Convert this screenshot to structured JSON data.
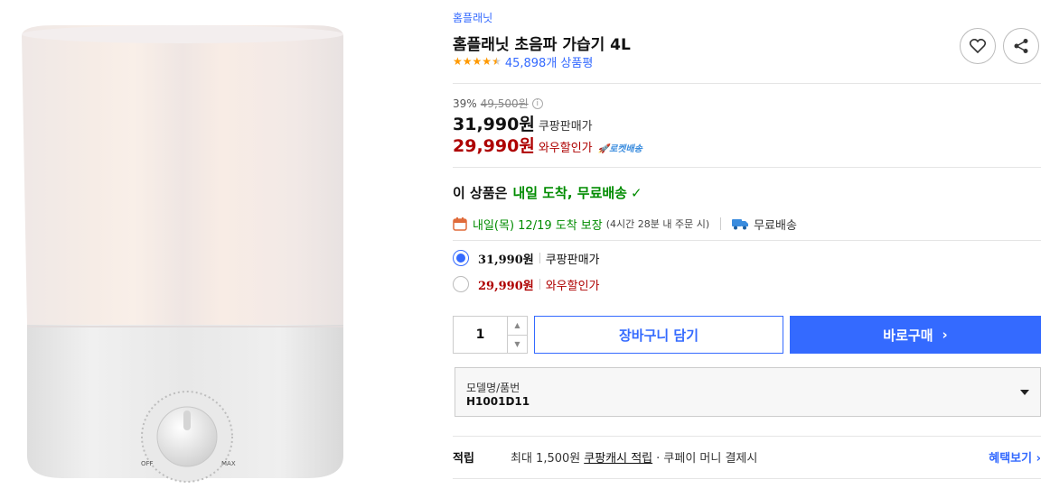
{
  "brand": "홈플래닛",
  "title": "홈플래닛 초음파 가습기 4L",
  "rating": {
    "value": 4.5,
    "count_text": "45,898개 상품평"
  },
  "price": {
    "discount": "39%",
    "original": "49,500원",
    "coupang_price": "31,990원",
    "coupang_label": "쿠팡판매가",
    "wow_price": "29,990원",
    "wow_label": "와우할인가",
    "rocket_badge": "로켓배송"
  },
  "delivery": {
    "head_prefix": "이 상품은",
    "head_highlight": "내일 도착, 무료배송",
    "date": "내일(목) 12/19 도착 보장",
    "note": "(4시간 28분 내 주문 시)",
    "free_shipping": "무료배송"
  },
  "options": [
    {
      "price": "31,990원",
      "label": "쿠팡판매가",
      "selected": true
    },
    {
      "price": "29,990원",
      "label": "와우할인가",
      "selected": false
    }
  ],
  "quantity": "1",
  "buttons": {
    "cart": "장바구니 담기",
    "buy": "바로구매"
  },
  "model": {
    "label": "모델명/품번",
    "value": "H1001D11"
  },
  "points": {
    "label": "적립",
    "text": "최대 1,500원",
    "link": "쿠팡캐시 적립",
    "rest": "· 쿠페이 머니 결제시",
    "benefit": "혜택보기"
  },
  "dial": {
    "off": "OFF",
    "max": "MAX"
  },
  "colors": {
    "accent": "#346aff",
    "sale": "#ae0000",
    "delivery": "#008c00",
    "star": "#ff9900"
  }
}
